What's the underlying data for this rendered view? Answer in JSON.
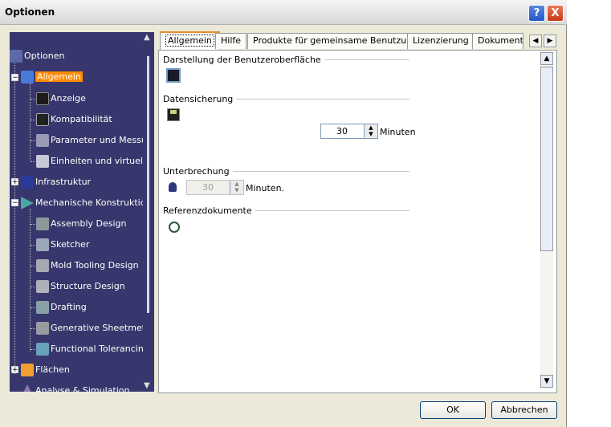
{
  "window": {
    "title": "Optionen",
    "help": "?",
    "close": "X"
  },
  "tree": {
    "root": "Optionen",
    "items": [
      {
        "label": "Allgemein",
        "level": 1,
        "selected": true,
        "expander": "-",
        "icon": "general-icon"
      },
      {
        "label": "Anzeige",
        "level": 2,
        "icon": "display-icon"
      },
      {
        "label": "Kompatibilität",
        "level": 2,
        "icon": "compatibility-icon"
      },
      {
        "label": "Parameter und Messung",
        "level": 2,
        "icon": "parameters-icon"
      },
      {
        "label": "Einheiten und virtuelle F",
        "level": 2,
        "icon": "units-icon"
      },
      {
        "label": "Infrastruktur",
        "level": 1,
        "expander": "+",
        "icon": "infrastructure-icon"
      },
      {
        "label": "Mechanische Konstruktion",
        "level": 1,
        "expander": "-",
        "icon": "mechanical-icon"
      },
      {
        "label": "Assembly Design",
        "level": 2,
        "icon": "assembly-icon"
      },
      {
        "label": "Sketcher",
        "level": 2,
        "icon": "sketcher-icon"
      },
      {
        "label": "Mold Tooling Design",
        "level": 2,
        "icon": "mold-icon"
      },
      {
        "label": "Structure Design",
        "level": 2,
        "icon": "structure-icon"
      },
      {
        "label": "Drafting",
        "level": 2,
        "icon": "drafting-icon"
      },
      {
        "label": "Generative Sheetmetal",
        "level": 2,
        "icon": "sheetmetal-icon"
      },
      {
        "label": "Functional Tolerancing",
        "level": 2,
        "icon": "tolerancing-icon"
      },
      {
        "label": "Flächen",
        "level": 1,
        "expander": "+",
        "icon": "surfaces-icon"
      },
      {
        "label": "Analyse & Simulation",
        "level": 1,
        "icon": "analysis-icon"
      }
    ]
  },
  "tabs": [
    "Allgemein",
    "Hilfe",
    "Produkte für gemeinsame Benutzung",
    "Lizenzierung",
    "Dokument"
  ],
  "active_tab": "Allgemein",
  "sections": {
    "ui_display": {
      "title": "Darstellung der Benutzeroberfläche"
    },
    "backup": {
      "title": "Datensicherung",
      "value": "30",
      "unit": "Minuten"
    },
    "interruption": {
      "title": "Unterbrechung",
      "value": "30",
      "unit": "Minuten."
    },
    "references": {
      "title": "Referenzdokumente"
    }
  },
  "buttons": {
    "ok": "OK",
    "cancel": "Abbrechen"
  },
  "colors": {
    "tree_bg": "#37376d",
    "selection": "#ff8a00",
    "tab_accent": "#e68b2c"
  }
}
